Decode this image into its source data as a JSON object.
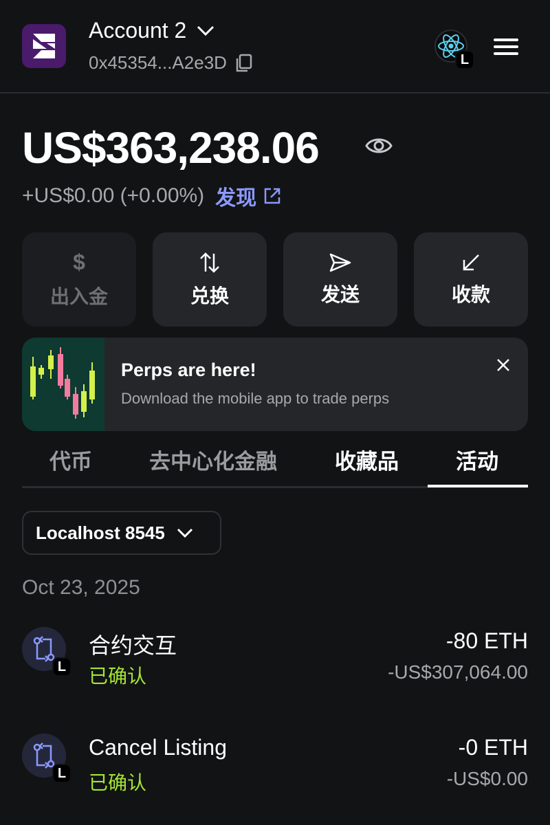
{
  "header": {
    "account_name": "Account 2",
    "account_address": "0x45354...A2e3D",
    "network_badge": "L",
    "icons": [
      "account-logo-icon",
      "chevron-down-icon",
      "copy-icon",
      "react-network-icon",
      "hamburger-menu-icon"
    ]
  },
  "balance": {
    "amount": "US$363,238.06",
    "change": "+US$0.00 (+0.00%)",
    "discover_label": "发现"
  },
  "actions": [
    {
      "label": "出入金",
      "icon": "dollar-icon",
      "enabled": false
    },
    {
      "label": "兑换",
      "icon": "swap-arrows-icon",
      "enabled": true
    },
    {
      "label": "发送",
      "icon": "send-icon",
      "enabled": true
    },
    {
      "label": "收款",
      "icon": "receive-arrow-icon",
      "enabled": true
    }
  ],
  "promo": {
    "title": "Perps are here!",
    "subtitle": "Download the mobile app to trade perps"
  },
  "tabs": [
    {
      "label": "代币",
      "active": false
    },
    {
      "label": "去中心化金融",
      "active": false
    },
    {
      "label": "收藏品",
      "active": false
    },
    {
      "label": "活动",
      "active": true
    }
  ],
  "network_filter": {
    "label": "Localhost 8545"
  },
  "activity": {
    "date": "Oct 23, 2025",
    "items": [
      {
        "title": "合约交互",
        "status": "已确认",
        "amount": "-80 ETH",
        "fiat": "-US$307,064.00",
        "badge": "L"
      },
      {
        "title": "Cancel Listing",
        "status": "已确认",
        "amount": "-0 ETH",
        "fiat": "-US$0.00",
        "badge": "L"
      }
    ]
  },
  "colors": {
    "background": "#121314",
    "card": "#24262a",
    "accent_link": "#8b99ff",
    "status_confirmed": "#a3e635",
    "muted_text": "#a7a9ad"
  }
}
